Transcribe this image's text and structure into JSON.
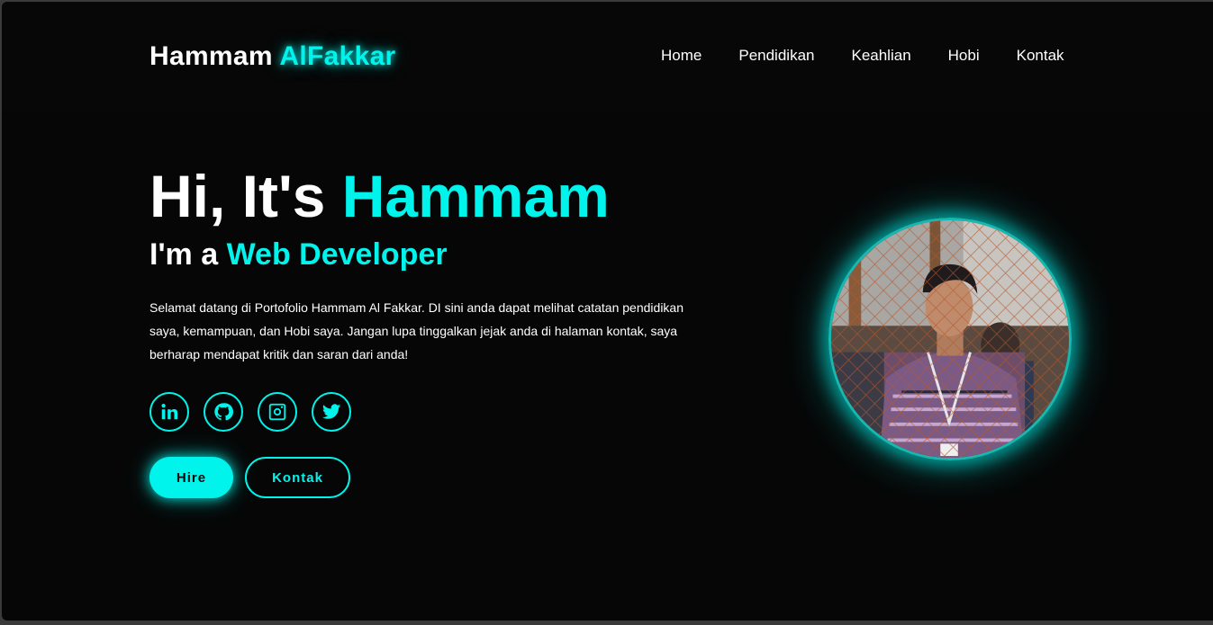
{
  "header": {
    "logo_name": "Hammam",
    "logo_accent": "AlFakkar",
    "nav": [
      "Home",
      "Pendidikan",
      "Keahlian",
      "Hobi",
      "Kontak"
    ]
  },
  "hero": {
    "greeting": "Hi, It's",
    "name": "Hammam",
    "role_prefix": "I'm a",
    "role": "Web Developer",
    "description": "Selamat datang di Portofolio Hammam Al Fakkar. DI sini anda dapat melihat catatan pendidikan saya, kemampuan, dan Hobi saya. Jangan lupa tinggalkan jejak anda di halaman kontak, saya berharap mendapat kritik dan saran dari anda!"
  },
  "socials": [
    {
      "icon": "linkedin-icon"
    },
    {
      "icon": "github-icon"
    },
    {
      "icon": "instagram-icon"
    },
    {
      "icon": "twitter-icon"
    }
  ],
  "buttons": {
    "hire": "Hire",
    "contact": "Kontak"
  },
  "colors": {
    "accent": "#00f4ec",
    "background": "#060606"
  }
}
